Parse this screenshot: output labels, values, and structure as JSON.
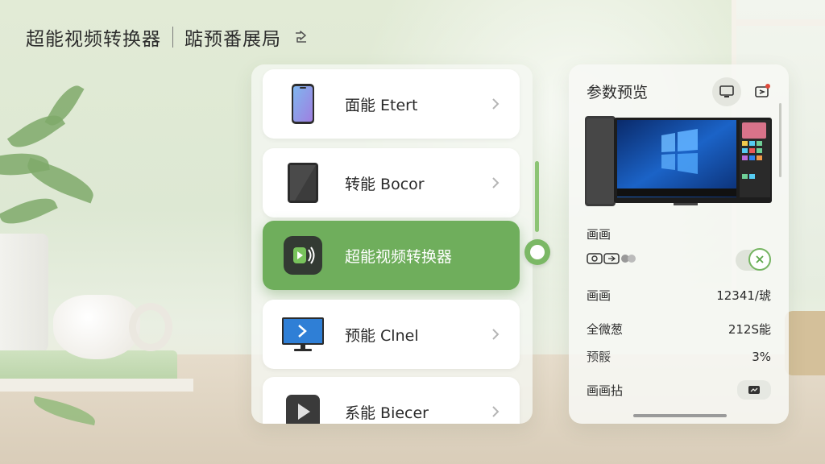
{
  "header": {
    "app_title": "超能视频转换器",
    "layout_title": "踮预番展局",
    "share_icon": "share-icon"
  },
  "devices": [
    {
      "label": "面能 Etert",
      "icon": "phone-icon"
    },
    {
      "label": "转能 Bocor",
      "icon": "tablet-icon"
    },
    {
      "label": "超能视频转换器",
      "icon": "app-cast-icon",
      "active": true
    },
    {
      "label": "预能 Clnel",
      "icon": "monitor-icon"
    },
    {
      "label": "系能 Biecer",
      "icon": "play-icon"
    }
  ],
  "preview": {
    "title": "参数预览",
    "section_label": "画画",
    "codec_badge": "",
    "rows": [
      {
        "label": "画画",
        "value": "12341/琥"
      },
      {
        "label": "全微葱",
        "value": "212S能"
      },
      {
        "label": "预骽",
        "value": "3%"
      },
      {
        "label": "画画拈",
        "value": ""
      }
    ]
  },
  "colors": {
    "accent": "#6fae5c",
    "panel": "#f5f7f2",
    "notification_dot": "#e04a3a"
  }
}
